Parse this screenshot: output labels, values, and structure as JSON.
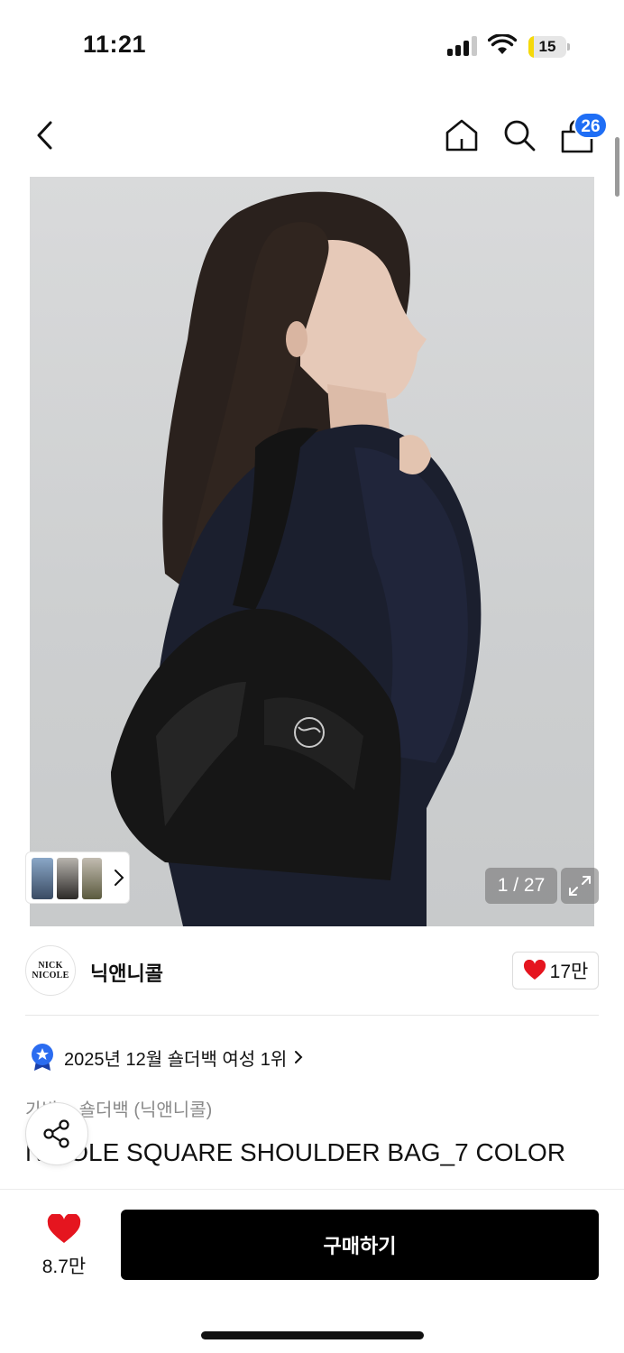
{
  "status_bar": {
    "time": "11:21",
    "battery": "15",
    "battery_level": 0.15,
    "signal_bars": 3
  },
  "nav": {
    "back_icon": "chevron-left-icon",
    "home_icon": "home-icon",
    "search_icon": "search-icon",
    "cart_icon": "shopping-bag-icon",
    "cart_count": "26",
    "badge_color": "#1f6ef5"
  },
  "gallery": {
    "page_indicator": "1 / 27",
    "expand_icon": "expand-icon",
    "thumbnails_icon": "chevron-right-icon"
  },
  "brand": {
    "logo_line1": "NICK",
    "logo_line2": "NICOLE",
    "name": "닉앤니콜",
    "like_count": "17만",
    "heart_color": "#e5151f"
  },
  "ranking": {
    "text": "2025년 12월 숄더백 여성 1위",
    "badge_icon": "ranking-medal-icon",
    "badge_color": "#2b6cf0"
  },
  "product": {
    "breadcrumb": "가방 > 숄더백 (닉앤니콜)",
    "title": "NICOLE SQUARE SHOULDER BAG_7 COLOR"
  },
  "share": {
    "icon": "share-icon"
  },
  "bottom_bar": {
    "wish_count": "8.7만",
    "buy_label": "구매하기"
  }
}
